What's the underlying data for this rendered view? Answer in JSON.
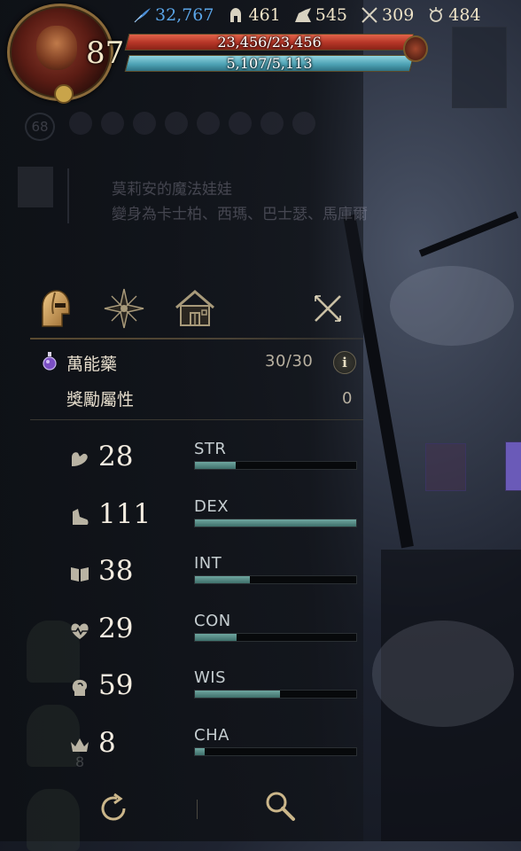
{
  "hud": {
    "level": "87",
    "hp_text": "23,456/23,456",
    "hp_fraction": 1.0,
    "mp_text": "5,107/5,113",
    "mp_fraction": 0.999,
    "stats": [
      {
        "icon": "quill-icon",
        "value": "32,767",
        "color": "#5aa4e6"
      },
      {
        "icon": "helmet-icon",
        "value": "461"
      },
      {
        "icon": "boot-icon",
        "value": "545"
      },
      {
        "icon": "crossed-swords-icon",
        "value": "309"
      },
      {
        "icon": "magic-circle-icon",
        "value": "484"
      }
    ]
  },
  "background_panel": {
    "level_badge": "68",
    "title": "莫莉安的魔法娃娃",
    "subtitle": "變身為卡士柏、西瑪、巴士瑟、馬庫爾"
  },
  "tabs": [
    {
      "icon": "helmet-icon",
      "active": true
    },
    {
      "icon": "compass-star-icon",
      "active": false
    },
    {
      "icon": "house-icon",
      "active": false
    },
    {
      "icon": "close-icon",
      "active": false
    }
  ],
  "potion": {
    "label": "萬能藥",
    "value": "30/30",
    "info_label": "i"
  },
  "bonus": {
    "label": "獎勵屬性",
    "value": "0"
  },
  "attributes": [
    {
      "name": "STR",
      "value": "28",
      "icon": "flexed-arm-icon",
      "progress": 0.25
    },
    {
      "name": "DEX",
      "value": "111",
      "icon": "boot-icon",
      "progress": 1.0
    },
    {
      "name": "INT",
      "value": "38",
      "icon": "book-icon",
      "progress": 0.34
    },
    {
      "name": "CON",
      "value": "29",
      "icon": "heartbeat-icon",
      "progress": 0.26
    },
    {
      "name": "WIS",
      "value": "59",
      "icon": "head-icon",
      "progress": 0.53
    },
    {
      "name": "CHA",
      "value": "8",
      "icon": "crown-icon",
      "progress": 0.06
    }
  ],
  "ghost_number": "8",
  "colors": {
    "hp": "#b43426",
    "mp": "#4ea3b5",
    "attr_bar": "#5a8f8a",
    "accent_gold": "#c9a44a"
  }
}
